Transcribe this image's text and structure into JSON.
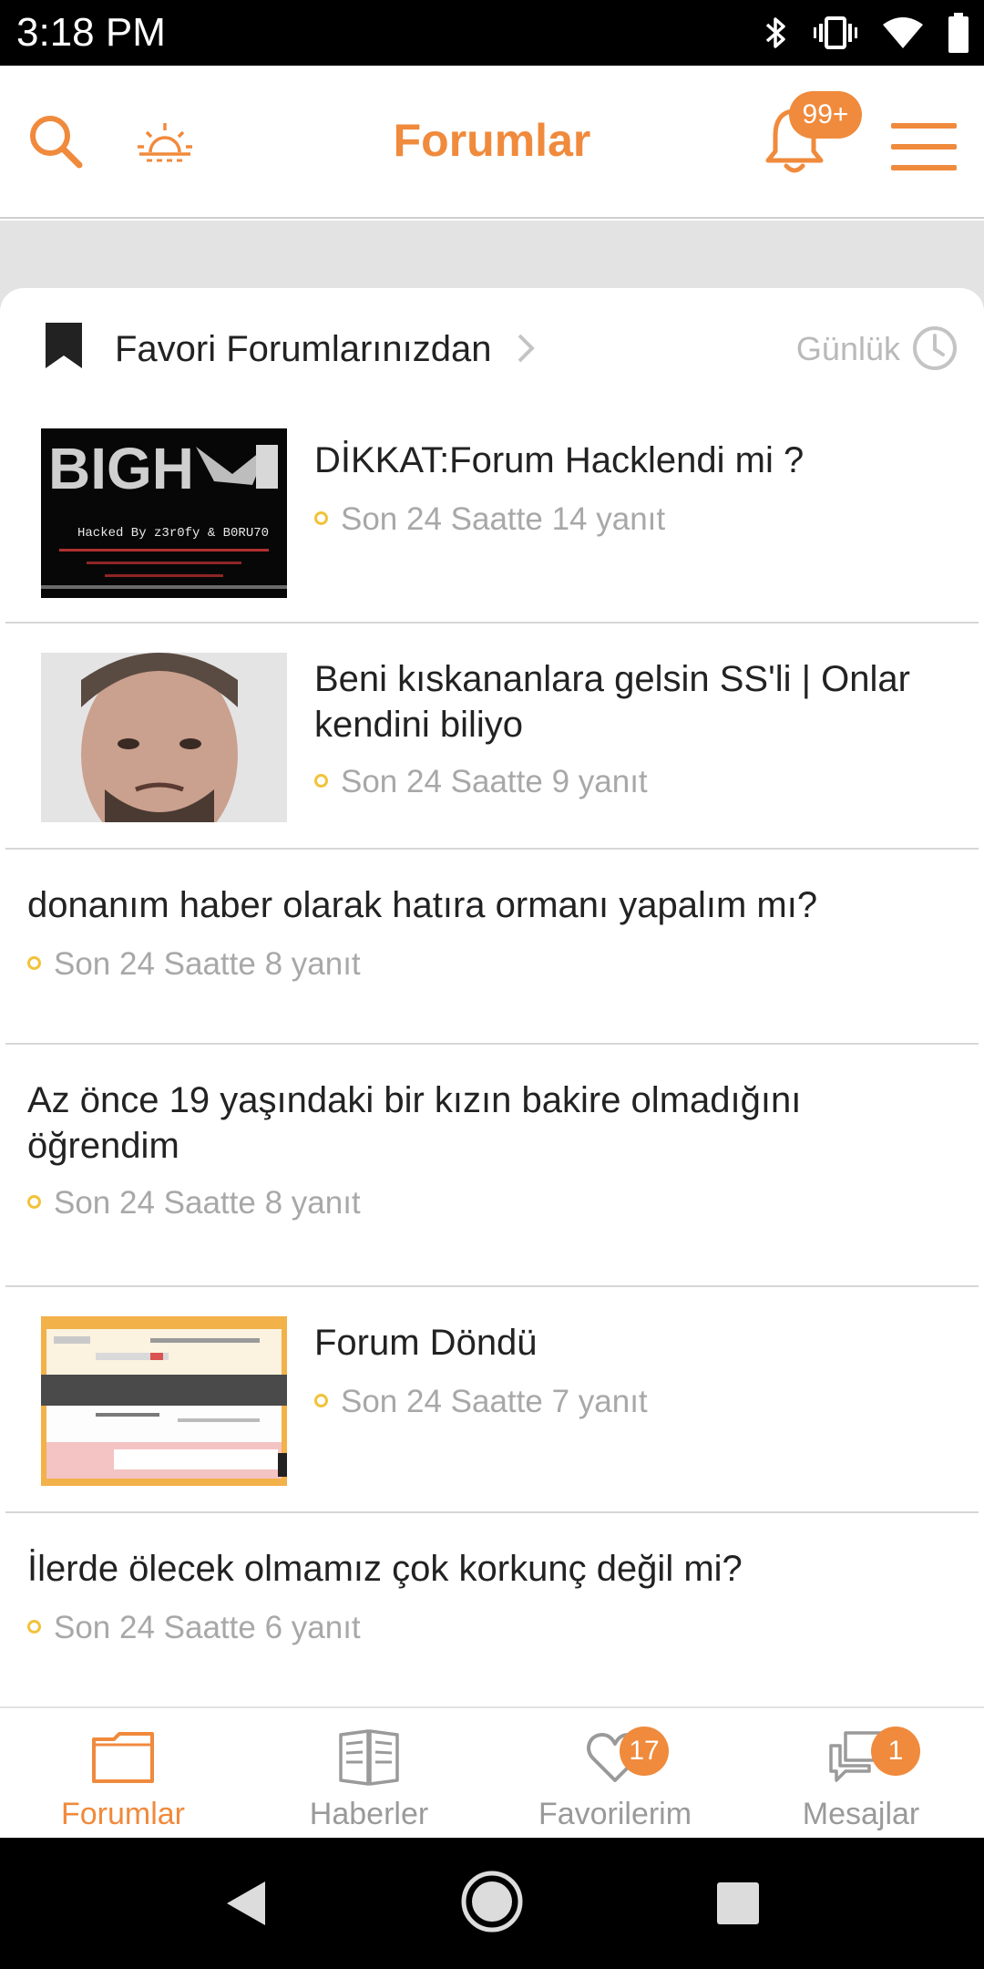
{
  "status_bar": {
    "time": "3:18 PM",
    "icons": [
      "bluetooth-icon",
      "vibrate-icon",
      "wifi-icon",
      "battery-icon"
    ]
  },
  "header": {
    "title": "Forumlar",
    "notification_badge": "99+",
    "accent_color": "#f08a3c"
  },
  "favorites": {
    "title": "Favori Forumlarınızdan",
    "period": "Günlük"
  },
  "topics": [
    {
      "title": "DİKKAT:Forum Hacklendi mi ?",
      "meta": "Son 24 Saatte 14 yanıt",
      "thumbnail": "hacked-banner",
      "thumb_caption": "Hacked By z3r0fy & B0RU70"
    },
    {
      "title": "Beni kıskananlara gelsin SS'li | Onlar kendini biliyo",
      "meta": "Son 24 Saatte 9 yanıt",
      "thumbnail": "man-portrait"
    },
    {
      "title": "donanım haber olarak hatıra ormanı yapalım mı?",
      "meta": "Son 24 Saatte 8 yanıt"
    },
    {
      "title": "Az önce 19 yaşındaki bir kızın bakire olmadığını öğrendim",
      "meta": "Son 24 Saatte 8 yanıt"
    },
    {
      "title": "Forum Döndü",
      "meta": "Son 24 Saatte 7 yanıt",
      "thumbnail": "forum-screenshot"
    },
    {
      "title": "İlerde ölecek olmamız çok korkunç değil mi?",
      "meta": "Son 24 Saatte 6 yanıt"
    }
  ],
  "bottom_nav": [
    {
      "label": "Forumlar",
      "icon": "folder-icon",
      "active": true
    },
    {
      "label": "Haberler",
      "icon": "newspaper-icon"
    },
    {
      "label": "Favorilerim",
      "icon": "heart-icon",
      "badge": "17"
    },
    {
      "label": "Mesajlar",
      "icon": "chat-icon",
      "badge": "1"
    }
  ]
}
